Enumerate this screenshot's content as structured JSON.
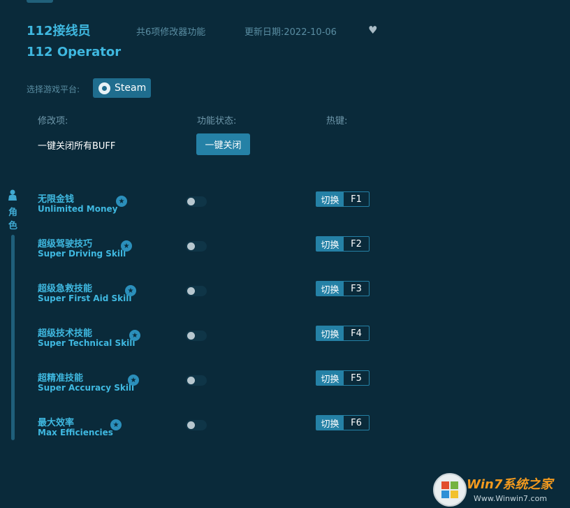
{
  "header": {
    "title_cn": "112接线员",
    "title_en": "112 Operator",
    "feature_count": "共6项修改器功能",
    "update_date": "更新日期:2022-10-06",
    "favorite_icon": "heart-icon"
  },
  "platform": {
    "label": "选择游戏平台:",
    "button": "Steam",
    "icon": "steam-icon"
  },
  "columns": {
    "mod": "修改项:",
    "status": "功能状态:",
    "hotkey": "热键:"
  },
  "all_buff": {
    "label": "一键关闭所有BUFF",
    "button": "一键关闭"
  },
  "sidebar": {
    "icon": "person-icon",
    "category": "角色"
  },
  "items": [
    {
      "cn": "无限金钱",
      "en": "Unlimited Money",
      "switch": "切换",
      "key": "F1",
      "enabled": false
    },
    {
      "cn": "超级驾驶技巧",
      "en": "Super Driving Skill",
      "switch": "切换",
      "key": "F2",
      "enabled": false
    },
    {
      "cn": "超级急救技能",
      "en": "Super First Aid Skill",
      "switch": "切换",
      "key": "F3",
      "enabled": false
    },
    {
      "cn": "超级技术技能",
      "en": "Super Technical Skill",
      "switch": "切换",
      "key": "F4",
      "enabled": false
    },
    {
      "cn": "超精准技能",
      "en": "Super Accuracy Skill",
      "switch": "切换",
      "key": "F5",
      "enabled": false
    },
    {
      "cn": "最大效率",
      "en": "Max Efficiencies",
      "switch": "切换",
      "key": "F6",
      "enabled": false
    }
  ],
  "watermark": {
    "brand": "Win7系统之家",
    "url": "Www.Winwin7.com"
  },
  "colors": {
    "background": "#0a2a3a",
    "accent": "#3fb8e0",
    "button": "#2581a6"
  }
}
